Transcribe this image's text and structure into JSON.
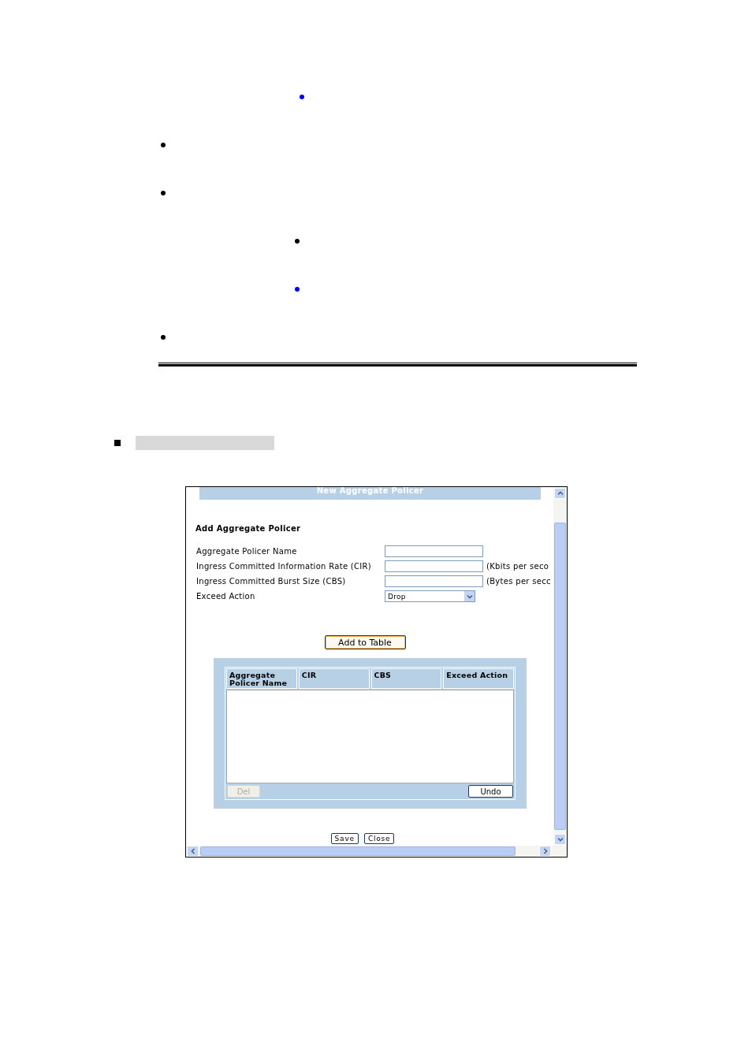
{
  "document": {
    "top_bullet": {
      "color": "#0000ff"
    },
    "bullets": [
      {
        "color": "#000000"
      },
      {
        "color": "#000000",
        "children": [
          {
            "color": "#000000"
          },
          {
            "color": "#0000ff"
          }
        ]
      },
      {
        "color": "#000000"
      }
    ]
  },
  "dialog": {
    "title": "New Aggregate Policer",
    "heading": "Add Aggregate Policer",
    "fields": [
      {
        "kind": "text",
        "label": "Aggregate Policer Name"
      },
      {
        "kind": "text",
        "label": "Ingress Committed Information Rate (CIR)",
        "suffix": "(Kbits per seco"
      },
      {
        "kind": "text",
        "label": "Ingress Committed Burst Size (CBS)",
        "suffix": "(Bytes per secc"
      },
      {
        "kind": "select",
        "label": "Exceed Action",
        "value": "Drop"
      }
    ],
    "add_button": "Add to Table",
    "table": {
      "columns": [
        "Aggregate Policer Name",
        "CIR",
        "CBS",
        "Exceed Action"
      ],
      "actions": [
        {
          "label": "Del",
          "disabled": true
        },
        {
          "label": "Undo",
          "disabled": false
        }
      ]
    },
    "buttons": [
      "Save",
      "Close"
    ]
  }
}
